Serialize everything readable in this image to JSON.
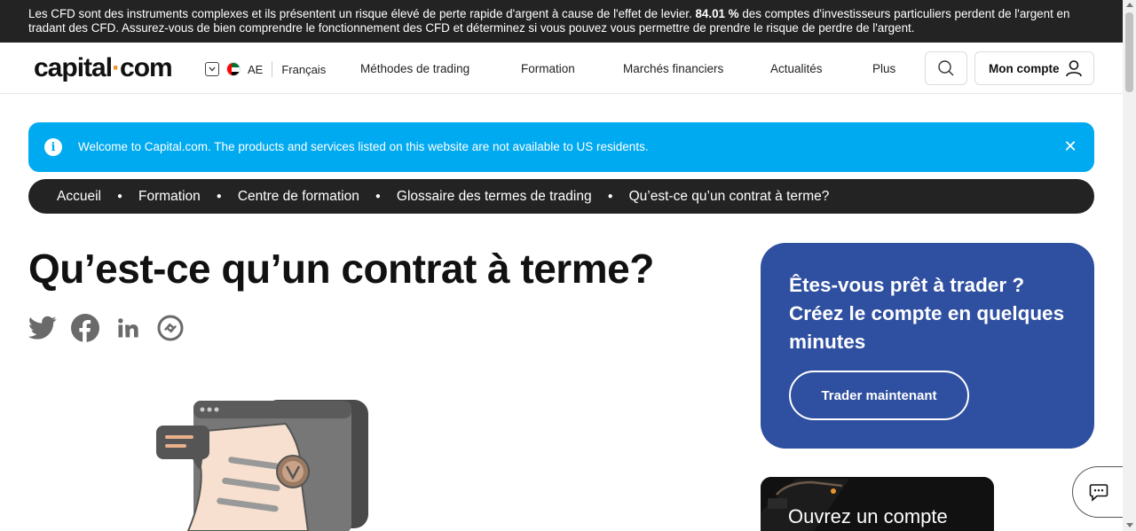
{
  "risk_banner": {
    "text_before": "Les CFD sont des instruments complexes et ils présentent un risque élevé de perte rapide d'argent à cause de l'effet de levier. ",
    "percentage": "84.01 %",
    "text_after": " des comptes d'investisseurs particuliers perdent de l'argent en tradant des CFD. Assurez-vous de bien comprendre le fonctionnement des CFD et déterminez si vous pouvez vous permettre de prendre le risque de perdre de l'argent."
  },
  "header": {
    "logo_part1": "capital",
    "logo_dot": "·",
    "logo_part2": "com",
    "region": "AE",
    "language": "Français",
    "nav": [
      "Méthodes de trading",
      "Formation",
      "Marchés financiers",
      "Actualités",
      "Plus"
    ],
    "account_label": "Mon compte"
  },
  "info_banner": {
    "message": "Welcome to Capital.com. The products and services listed on this website are not available to US residents.",
    "icon_glyph": "i",
    "close_glyph": "✕"
  },
  "breadcrumb": [
    "Accueil",
    "Formation",
    "Centre de formation",
    "Glossaire des termes de trading",
    "Qu’est-ce qu’un contrat à terme?"
  ],
  "page_title": "Qu’est-ce qu’un contrat à terme?",
  "share_icons": [
    "twitter-icon",
    "facebook-icon",
    "linkedin-icon",
    "copy-link-icon"
  ],
  "promo": {
    "title": "Êtes-vous prêt à trader ? Créez le compte en quelques minutes",
    "button": "Trader maintenant"
  },
  "app_card": {
    "text": "Ouvrez un compte"
  },
  "colors": {
    "risk_bg": "#232323",
    "info_bg": "#00aaf1",
    "breadcrumb_bg": "#232323",
    "promo_bg": "#2f4fa0",
    "logo_dot": "#e9932b"
  }
}
